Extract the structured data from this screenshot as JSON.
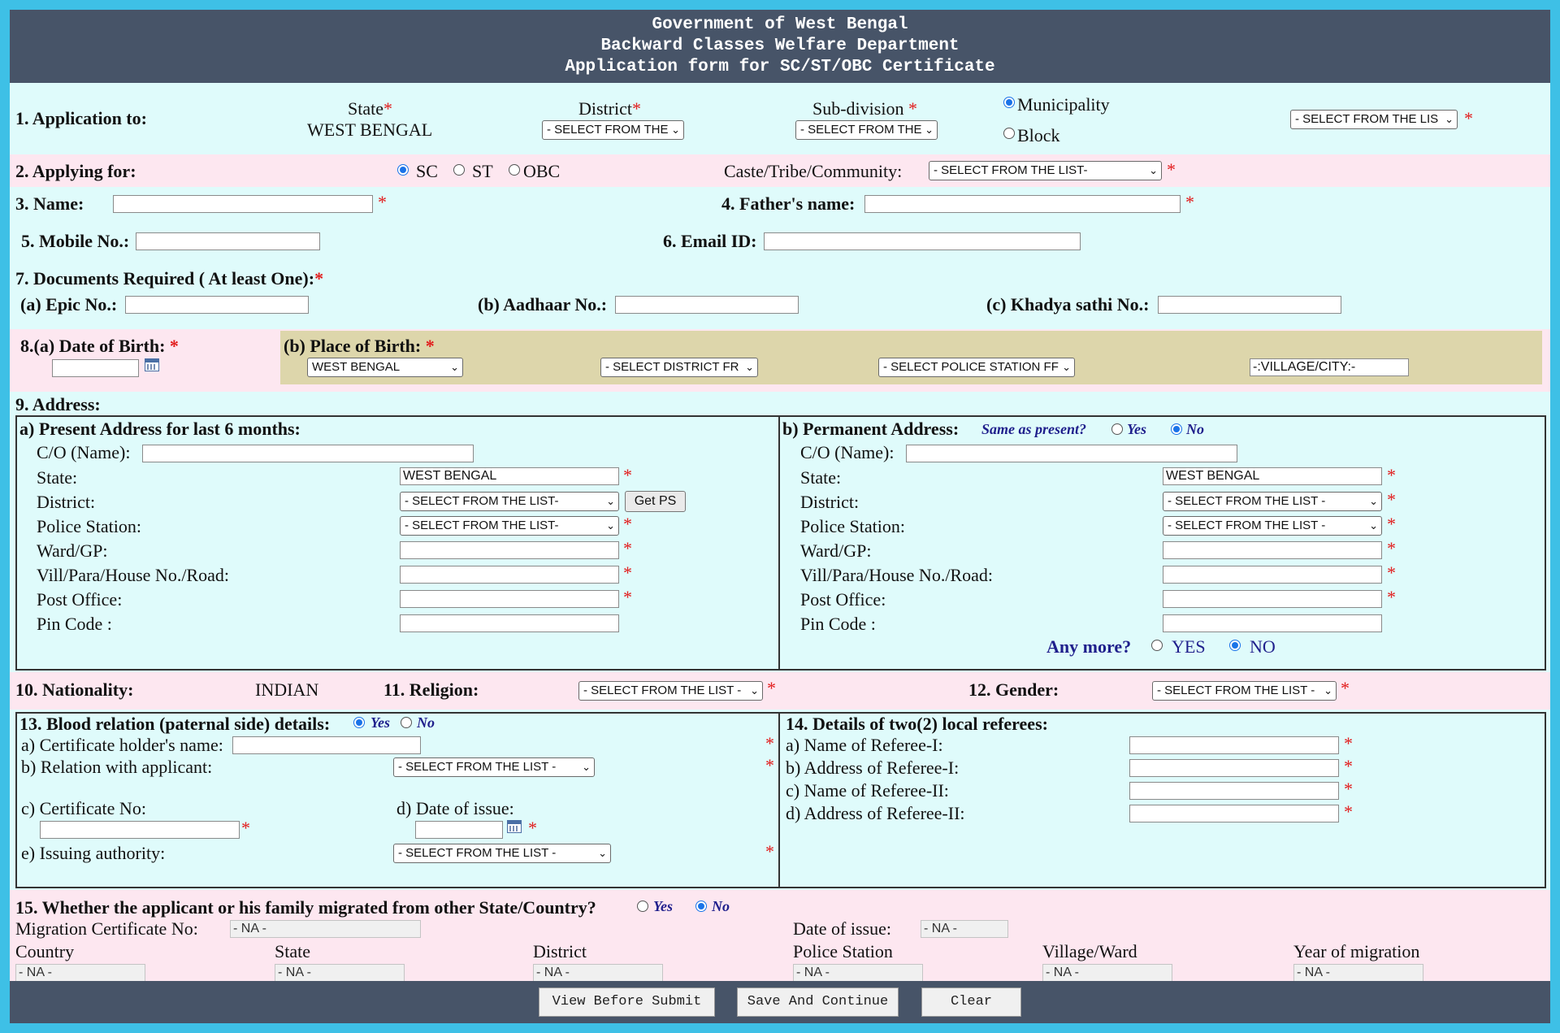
{
  "header": {
    "line1": "Government of West Bengal",
    "line2": "Backward Classes Welfare Department",
    "line3": "Application form for SC/ST/OBC Certificate"
  },
  "s1": {
    "label": "1. Application to:",
    "state_label": "State",
    "state_value": "WEST BENGAL",
    "district_label": "District",
    "district_select": "- SELECT FROM THE",
    "subdiv_label": "Sub-division",
    "subdiv_select": "- SELECT FROM THE",
    "municipality": "Municipality",
    "block": "Block",
    "mun_select": "- SELECT FROM THE LIS"
  },
  "s2": {
    "label": "2. Applying for:",
    "sc": "SC",
    "st": "ST",
    "obc": "OBC",
    "caste_label": "Caste/Tribe/Community:",
    "caste_select": "- SELECT FROM THE LIST-"
  },
  "s3": {
    "label": "3. Name:"
  },
  "s4": {
    "label": "4. Father's name:"
  },
  "s5": {
    "label": "5. Mobile No.:"
  },
  "s6": {
    "label": "6. Email ID:"
  },
  "s7": {
    "label": "7. Documents Required ( At least One):",
    "epic": "(a) Epic No.:",
    "aadhaar": "(b) Aadhaar No.:",
    "khadya": "(c) Khadya sathi No.:"
  },
  "s8": {
    "dob_label": "8.(a) Date of Birth:",
    "pob_label": "(b) Place of Birth:",
    "state_select": "WEST BENGAL",
    "district_select": "- SELECT DISTRICT FR",
    "ps_select": "- SELECT POLICE STATION FF",
    "village": "-:VILLAGE/CITY:-"
  },
  "s9": {
    "label": "9. Address:",
    "present_title": "a) Present Address for last 6 months:",
    "permanent_title": "b) Permanent Address:",
    "same_q": "Same as present?",
    "yes": "Yes",
    "no": "No",
    "co": "C/O (Name):",
    "state": "State:",
    "district": "District:",
    "ps": "Police Station:",
    "ward": "Ward/GP:",
    "vill": "Vill/Para/House No./Road:",
    "po": "Post Office:",
    "pin": "Pin Code :",
    "state_value": "WEST BENGAL",
    "present_select": "- SELECT FROM THE LIST-",
    "perm_select": "- SELECT FROM THE LIST -",
    "getps": "Get PS",
    "any_more": "Any more?",
    "any_yes": "YES",
    "any_no": "NO"
  },
  "s10": {
    "label": "10. Nationality:",
    "value": "INDIAN",
    "religion_label": "11. Religion:",
    "religion_select": "- SELECT FROM THE LIST -",
    "gender_label": "12. Gender:",
    "gender_select": "- SELECT FROM THE LIST -"
  },
  "s13": {
    "label": "13. Blood relation (paternal side) details:",
    "yes": "Yes",
    "no": "No",
    "a": "a) Certificate holder's name:",
    "b": "b) Relation with applicant:",
    "relation_select": "- SELECT FROM THE LIST -",
    "c": "c) Certificate No:",
    "d": "d) Date of issue:",
    "e": "e) Issuing authority:",
    "authority_select": "- SELECT FROM THE LIST -"
  },
  "s14": {
    "label": "14. Details of two(2) local referees:",
    "a": "a) Name of Referee-I:",
    "b": "b) Address of Referee-I:",
    "c": "c) Name of Referee-II:",
    "d": "d) Address of Referee-II:"
  },
  "s15": {
    "label": "15. Whether the applicant or his family migrated from other State/Country?",
    "yes": "Yes",
    "no": "No",
    "mig_label": "Migration Certificate No:",
    "doi_label": "Date of issue:",
    "na": "- NA -",
    "country": "Country",
    "state": "State",
    "district": "District",
    "ps": "Police Station",
    "village": "Village/Ward",
    "year": "Year of migration"
  },
  "buttons": {
    "view": "View Before Submit",
    "save": "Save And Continue",
    "clear": "Clear"
  },
  "req": "*",
  "chev": "⌄",
  "colors": {
    "outer": "#3ec0e6",
    "header": "#475468",
    "page_bg": "#dffbfb",
    "pink_band": "#fde7f0",
    "khaki_band": "#ddd6ab",
    "required": "#e21b1b",
    "radio_on": "#1a73e8"
  }
}
